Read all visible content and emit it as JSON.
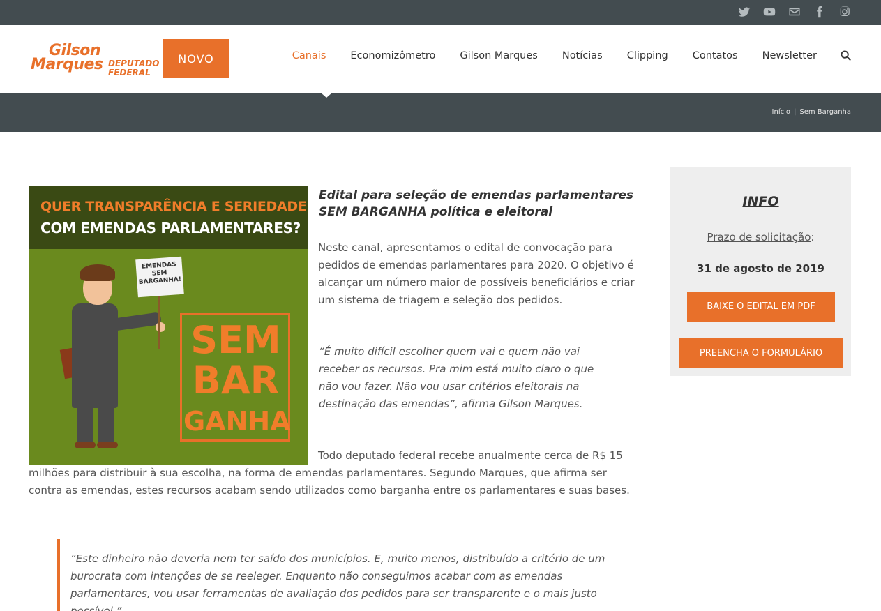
{
  "social": {
    "icons": [
      "twitter-icon",
      "youtube-icon",
      "email-icon",
      "facebook-icon",
      "instagram-icon"
    ]
  },
  "logo": {
    "name_line1": "Gilson",
    "name_line2": "Marques",
    "role_line1": "DEPUTADO",
    "role_line2": "FEDERAL",
    "party": "NOVO"
  },
  "nav": {
    "items": [
      {
        "label": "Canais",
        "active": true
      },
      {
        "label": "Economizômetro",
        "active": false
      },
      {
        "label": "Gilson Marques",
        "active": false
      },
      {
        "label": "Notícias",
        "active": false
      },
      {
        "label": "Clipping",
        "active": false
      },
      {
        "label": "Contatos",
        "active": false
      },
      {
        "label": "Newsletter",
        "active": false
      }
    ]
  },
  "breadcrumb": {
    "home": "Início",
    "separator": "|",
    "current": "Sem Barganha"
  },
  "hero": {
    "line1": "QUER TRANSPARÊNCIA E SERIEDADE",
    "line2": "COM EMENDAS PARLAMENTARES?",
    "sign": "EMENDAS SEM BARGANHA!",
    "big1": "SEM",
    "big2": "BAR",
    "big3": "GANHA"
  },
  "article": {
    "title": "Edital para seleção de emendas parlamentares SEM BARGANHA política e eleitoral",
    "p1": "Neste canal, apresentamos o edital de convocação para pedidos de emendas parlamentares para 2020. O objetivo é alcançar um número maior de possíveis beneficiários e criar um sistema de triagem e seleção dos pedidos.",
    "quote1": "“É muito difícil escolher quem vai e quem não vai receber os recursos. Pra mim está muito claro o que não vou fazer. Não vou usar critérios eleitorais na destinação das emendas”, afirma Gilson Marques.",
    "p2": "Todo deputado federal recebe anualmente cerca de R$ 15 milhões para distribuir à sua escolha, na forma de emendas parlamentares. Segundo Marques, que afirma ser contra as emendas, estes recursos acabam sendo utilizados como barganha entre os parlamentares e suas bases.",
    "blockquote": "“Este dinheiro não deveria nem ter saído dos municípios. E, muito menos, distribuído a critério de um burocrata com intenções de se reeleger. Enquanto não conseguimos acabar com as emendas parlamentares, vou usar ferramentas de avaliação dos pedidos para ser transparente e o mais justo possível.”"
  },
  "sidebar": {
    "title": "INFO",
    "prazo_label": "Prazo de solicitação",
    "prazo_suffix": ":",
    "date": "31 de agosto de 2019",
    "btn_pdf": "BAIXE O EDITAL EM PDF",
    "btn_form": "PREENCHA O FORMULÁRIO"
  },
  "colors": {
    "accent": "#e8702a",
    "dark_bar": "#434c50",
    "sidebar_bg": "#eeeeee"
  }
}
